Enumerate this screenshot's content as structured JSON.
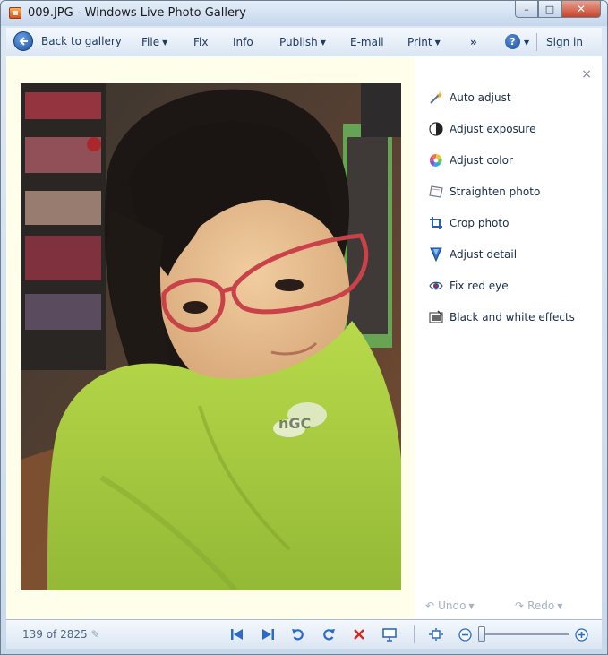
{
  "window": {
    "title": "009.JPG - Windows Live Photo Gallery",
    "caption_buttons": {
      "minimize": "–",
      "maximize": "□",
      "close": "✕"
    }
  },
  "menubar": {
    "back_label": "Back to gallery",
    "items": {
      "file": "File",
      "fix": "Fix",
      "info": "Info",
      "publish": "Publish",
      "email": "E-mail",
      "print": "Print",
      "overflow": "»"
    },
    "help": "?",
    "sign_in": "Sign in"
  },
  "fix_panel": {
    "close": "×",
    "items": [
      {
        "label": "Auto adjust",
        "icon": "magic-wand-icon"
      },
      {
        "label": "Adjust exposure",
        "icon": "exposure-icon"
      },
      {
        "label": "Adjust color",
        "icon": "color-wheel-icon"
      },
      {
        "label": "Straighten photo",
        "icon": "straighten-icon"
      },
      {
        "label": "Crop photo",
        "icon": "crop-icon"
      },
      {
        "label": "Adjust detail",
        "icon": "detail-icon"
      },
      {
        "label": "Fix red eye",
        "icon": "red-eye-icon"
      },
      {
        "label": "Black and white effects",
        "icon": "black-white-icon"
      }
    ],
    "undo": "Undo",
    "redo": "Redo"
  },
  "statusbar": {
    "counter": "139 of 2825",
    "zoom_level": 0.0
  },
  "colors": {
    "accent": "#2a6bc9",
    "delete": "#d7261e",
    "photo_bg": "#fefeea"
  }
}
